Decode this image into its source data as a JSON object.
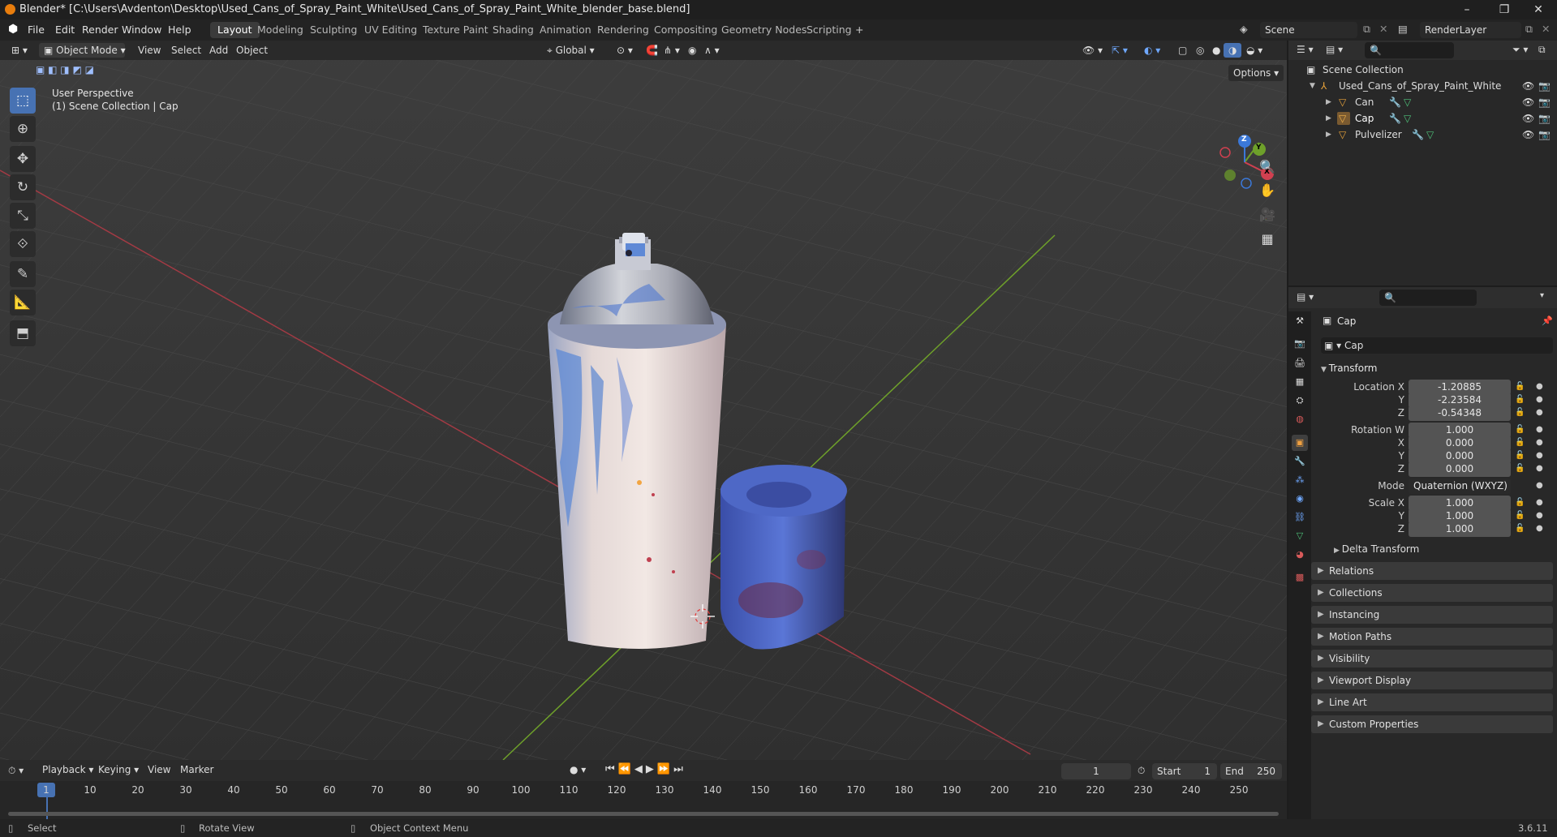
{
  "window": {
    "title": "Blender* [C:\\Users\\Avdenton\\Desktop\\Used_Cans_of_Spray_Paint_White\\Used_Cans_of_Spray_Paint_White_blender_base.blend]",
    "minimize": "–",
    "maximize": "❐",
    "close": "✕"
  },
  "menu": {
    "items": [
      "File",
      "Edit",
      "Render",
      "Window",
      "Help"
    ]
  },
  "workspaces": {
    "tabs": [
      "Layout",
      "Modeling",
      "Sculpting",
      "UV Editing",
      "Texture Paint",
      "Shading",
      "Animation",
      "Rendering",
      "Compositing",
      "Geometry Nodes",
      "Scripting"
    ],
    "active": "Layout",
    "add": "+"
  },
  "scene": {
    "name": "Scene",
    "render_layer": "RenderLayer"
  },
  "viewport": {
    "mode": "Object Mode",
    "menus": [
      "View",
      "Select",
      "Add",
      "Object"
    ],
    "orientation": "Global",
    "options": "Options",
    "overlay_title": "User Perspective",
    "overlay_subtitle": "(1) Scene Collection | Cap",
    "gizmo": {
      "x": "X",
      "y": "Y",
      "z": "Z"
    }
  },
  "outliner": {
    "root": "Scene Collection",
    "collection": "Used_Cans_of_Spray_Paint_White",
    "objects": [
      "Can",
      "Cap",
      "Pulvelizer"
    ]
  },
  "properties": {
    "object_name": "Cap",
    "datablock_name": "Cap",
    "transform": {
      "header": "Transform",
      "location_x_label": "Location X",
      "axis_y": "Y",
      "axis_z": "Z",
      "axis_x": "X",
      "location": [
        "-1.20885",
        "-2.23584",
        "-0.54348"
      ],
      "rotation_w_label": "Rotation W",
      "rotation": [
        "1.000",
        "0.000",
        "0.000",
        "0.000"
      ],
      "mode_label": "Mode",
      "mode_value": "Quaternion (WXYZ)",
      "scale_x_label": "Scale X",
      "scale": [
        "1.000",
        "1.000",
        "1.000"
      ],
      "delta": "Delta Transform"
    },
    "panels": [
      "Relations",
      "Collections",
      "Instancing",
      "Motion Paths",
      "Visibility",
      "Viewport Display",
      "Line Art",
      "Custom Properties"
    ]
  },
  "timeline": {
    "menus": [
      "Playback",
      "Keying",
      "View",
      "Marker"
    ],
    "current_frame": "1",
    "start_label": "Start",
    "start": "1",
    "end_label": "End",
    "end": "250",
    "ticks": [
      "1",
      "10",
      "20",
      "30",
      "40",
      "50",
      "60",
      "70",
      "80",
      "90",
      "100",
      "110",
      "120",
      "130",
      "140",
      "150",
      "160",
      "170",
      "180",
      "190",
      "200",
      "210",
      "220",
      "230",
      "240",
      "250"
    ]
  },
  "status": {
    "select": "Select",
    "rotate": "Rotate View",
    "context": "Object Context Menu",
    "version": "3.6.11"
  }
}
